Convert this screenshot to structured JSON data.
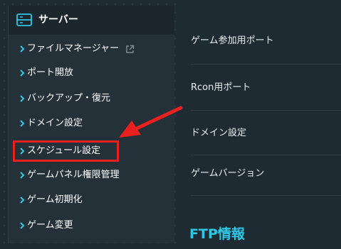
{
  "sidebar": {
    "title": "サーバー",
    "items": [
      {
        "label": "ファイルマネージャー",
        "external": true
      },
      {
        "label": "ポート開放"
      },
      {
        "label": "バックアップ・復元"
      },
      {
        "label": "ドメイン設定"
      },
      {
        "label": "スケジュール設定",
        "highlighted": true
      },
      {
        "label": "ゲームパネル権限管理"
      },
      {
        "label": "ゲーム初期化"
      },
      {
        "label": "ゲーム変更"
      }
    ]
  },
  "main": {
    "rows": [
      {
        "label": "ゲーム参加用ポート"
      },
      {
        "label": "Rcon用ポート"
      },
      {
        "label": "ドメイン設定"
      },
      {
        "label": "ゲームバージョン"
      }
    ],
    "section_title": "FTP情報"
  },
  "colors": {
    "accent": "#2ec7e6",
    "highlight": "#e8201e",
    "sidebar_bg": "#243139",
    "page_bg": "#1e2b33"
  },
  "icons": {
    "header": "server-icon",
    "chevron": "chevron-right-icon",
    "external": "external-link-icon"
  }
}
